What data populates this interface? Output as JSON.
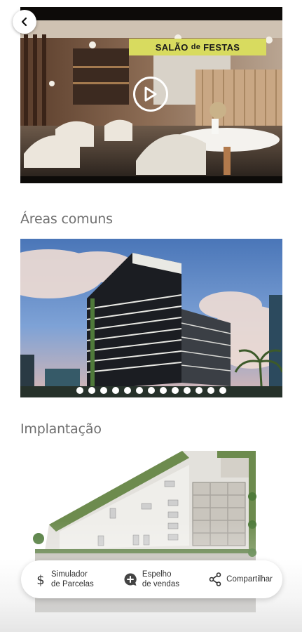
{
  "video": {
    "tag_prefix": "SALÃO",
    "tag_mid": "de",
    "tag_suffix": "FESTAS"
  },
  "sections": {
    "common_areas_title": "Áreas comuns",
    "site_plan_title": "Implantação"
  },
  "gallery": {
    "slide_count": 13,
    "active_index": 0
  },
  "actions": {
    "simulator_line1": "Simulador",
    "simulator_line2": "de Parcelas",
    "mirror_line1": "Espelho",
    "mirror_line2": "de vendas",
    "share": "Compartilhar"
  },
  "icons": {
    "back": "chevron-left-icon",
    "play": "play-icon",
    "simulator": "dollar-icon",
    "mirror": "chat-plus-icon",
    "share": "share-icon"
  }
}
